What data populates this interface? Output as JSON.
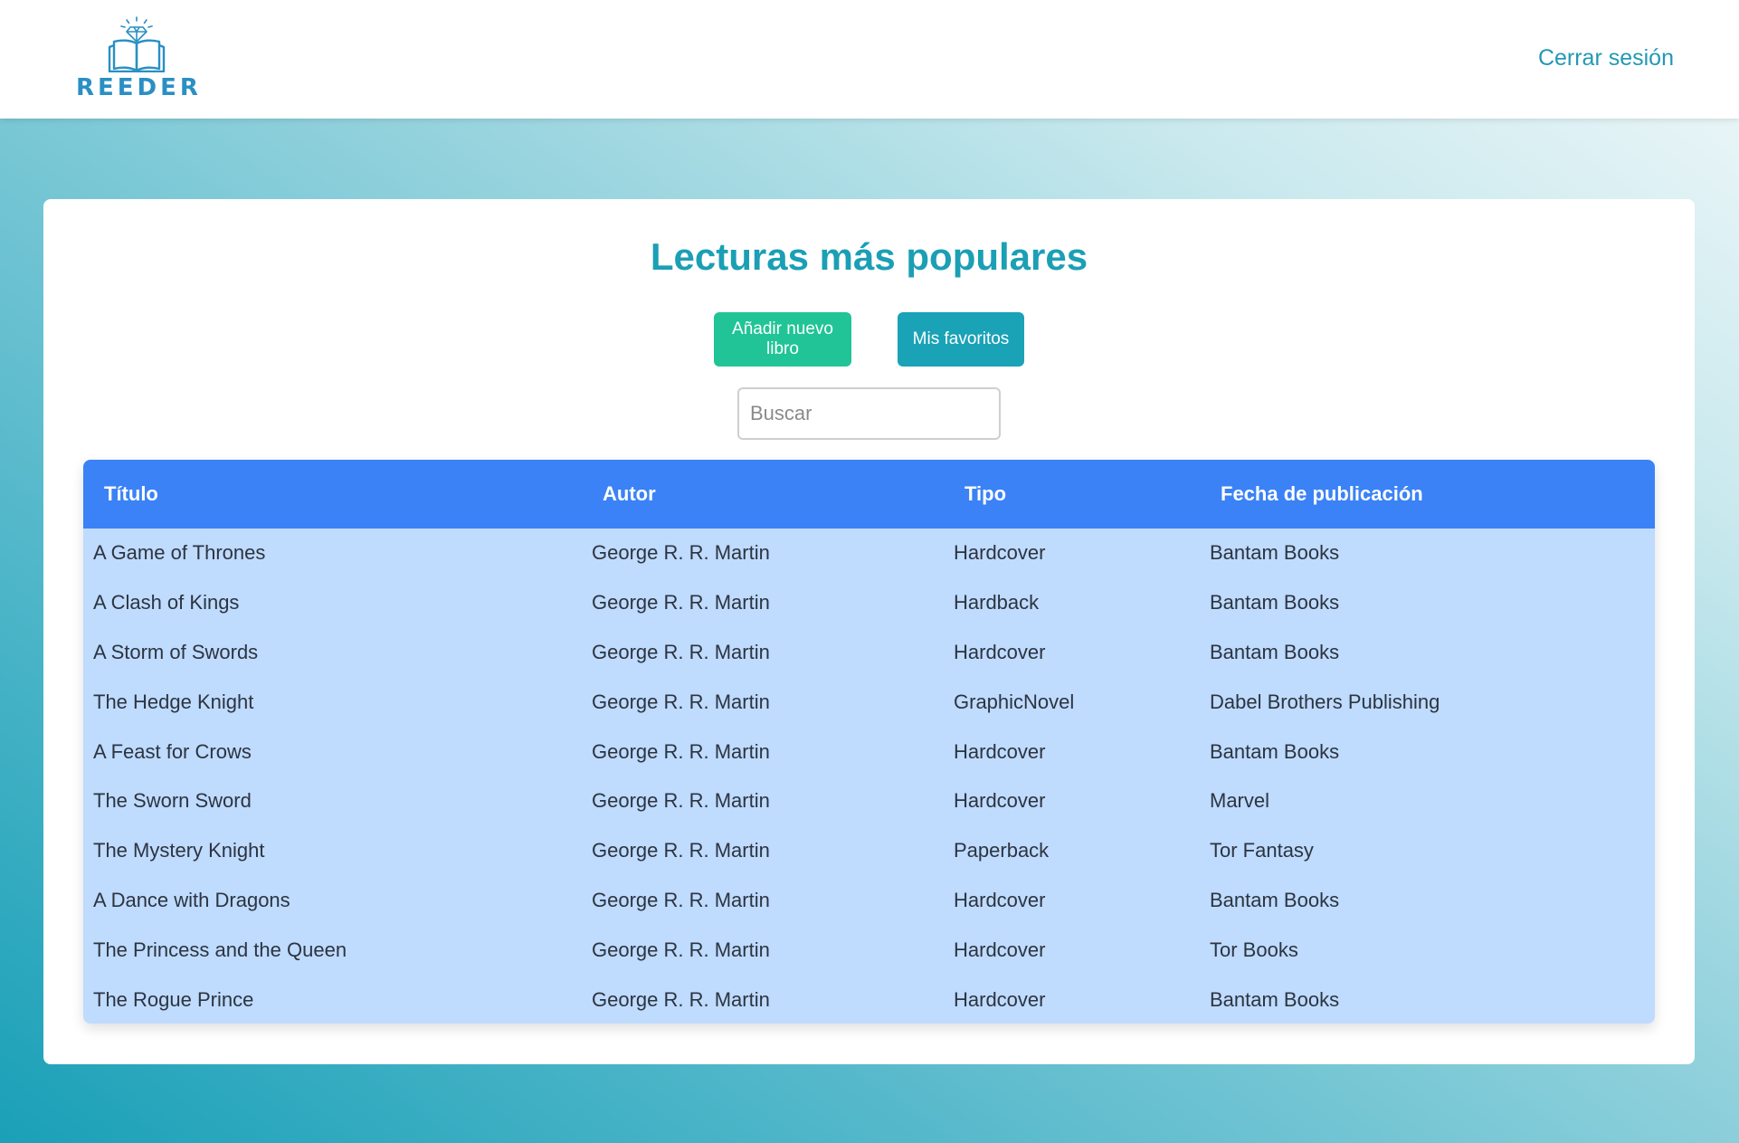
{
  "header": {
    "brand": "REEDER",
    "logout_label": "Cerrar sesión"
  },
  "main": {
    "title": "Lecturas más populares",
    "add_book_label": "Añadir nuevo libro",
    "favorites_label": "Mis favoritos",
    "search": {
      "placeholder": "Buscar",
      "value": ""
    },
    "table": {
      "columns": [
        "Título",
        "Autor",
        "Tipo",
        "Fecha de publicación"
      ],
      "rows": [
        [
          "A Game of Thrones",
          "George R. R. Martin",
          "Hardcover",
          "Bantam Books"
        ],
        [
          "A Clash of Kings",
          "George R. R. Martin",
          "Hardback",
          "Bantam Books"
        ],
        [
          "A Storm of Swords",
          "George R. R. Martin",
          "Hardcover",
          "Bantam Books"
        ],
        [
          "The Hedge Knight",
          "George R. R. Martin",
          "GraphicNovel",
          "Dabel Brothers Publishing"
        ],
        [
          "A Feast for Crows",
          "George R. R. Martin",
          "Hardcover",
          "Bantam Books"
        ],
        [
          "The Sworn Sword",
          "George R. R. Martin",
          "Hardcover",
          "Marvel"
        ],
        [
          "The Mystery Knight",
          "George R. R. Martin",
          "Paperback",
          "Tor Fantasy"
        ],
        [
          "A Dance with Dragons",
          "George R. R. Martin",
          "Hardcover",
          "Bantam Books"
        ],
        [
          "The Princess and the Queen",
          "George R. R. Martin",
          "Hardcover",
          "Tor Books"
        ],
        [
          "The Rogue Prince",
          "George R. R. Martin",
          "Hardcover",
          "Bantam Books"
        ]
      ]
    }
  },
  "colors": {
    "brand": "#2a8fc4",
    "title": "#1b9fb5",
    "add_button": "#20c497",
    "favorites_button": "#1aa2b7",
    "table_header": "#3b82f6",
    "table_body": "#bfdbfe"
  },
  "icons": {
    "logo": "open-book-diamond-icon"
  }
}
